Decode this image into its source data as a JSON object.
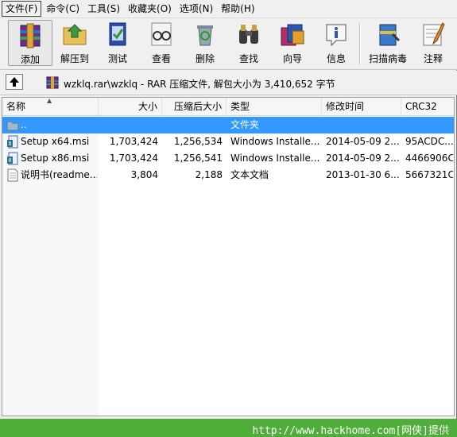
{
  "menu": [
    {
      "label": "文件(F)",
      "active": true
    },
    {
      "label": "命令(C)"
    },
    {
      "label": "工具(S)"
    },
    {
      "label": "收藏夹(O)"
    },
    {
      "label": "选项(N)"
    },
    {
      "label": "帮助(H)"
    }
  ],
  "toolbar": {
    "add": "添加",
    "extract_to": "解压到",
    "test": "测试",
    "view": "查看",
    "delete": "删除",
    "find": "查找",
    "wizard": "向导",
    "info": "信息",
    "virus_scan": "扫描病毒",
    "comment": "注释"
  },
  "address": {
    "text": "wzklq.rar\\wzklq - RAR 压缩文件, 解包大小为 3,410,652 字节"
  },
  "columns": {
    "name": "名称",
    "size": "大小",
    "packed": "压缩后大小",
    "type": "类型",
    "modified": "修改时间",
    "crc": "CRC32"
  },
  "files": [
    {
      "name": "..",
      "size": "",
      "packed": "",
      "type": "文件夹",
      "modified": "",
      "crc": "",
      "icon": "folder-up-icon",
      "selected": true
    },
    {
      "name": "Setup x64.msi",
      "size": "1,703,424",
      "packed": "1,256,534",
      "type": "Windows Installe...",
      "modified": "2014-05-09 2...",
      "crc": "95ACDC...",
      "icon": "msi-file-icon"
    },
    {
      "name": "Setup x86.msi",
      "size": "1,703,424",
      "packed": "1,256,541",
      "type": "Windows Installe...",
      "modified": "2014-05-09 2...",
      "crc": "4466906C",
      "icon": "msi-file-icon"
    },
    {
      "name": "说明书(readme...",
      "size": "3,804",
      "packed": "2,188",
      "type": "文本文档",
      "modified": "2013-01-30 6...",
      "crc": "5667321C",
      "icon": "text-file-icon"
    }
  ],
  "watermark": "http://www.hackhome.com[网侠]提供",
  "colors": {
    "selection": "#3399ff",
    "watermark_bg": "#4fae3a"
  }
}
